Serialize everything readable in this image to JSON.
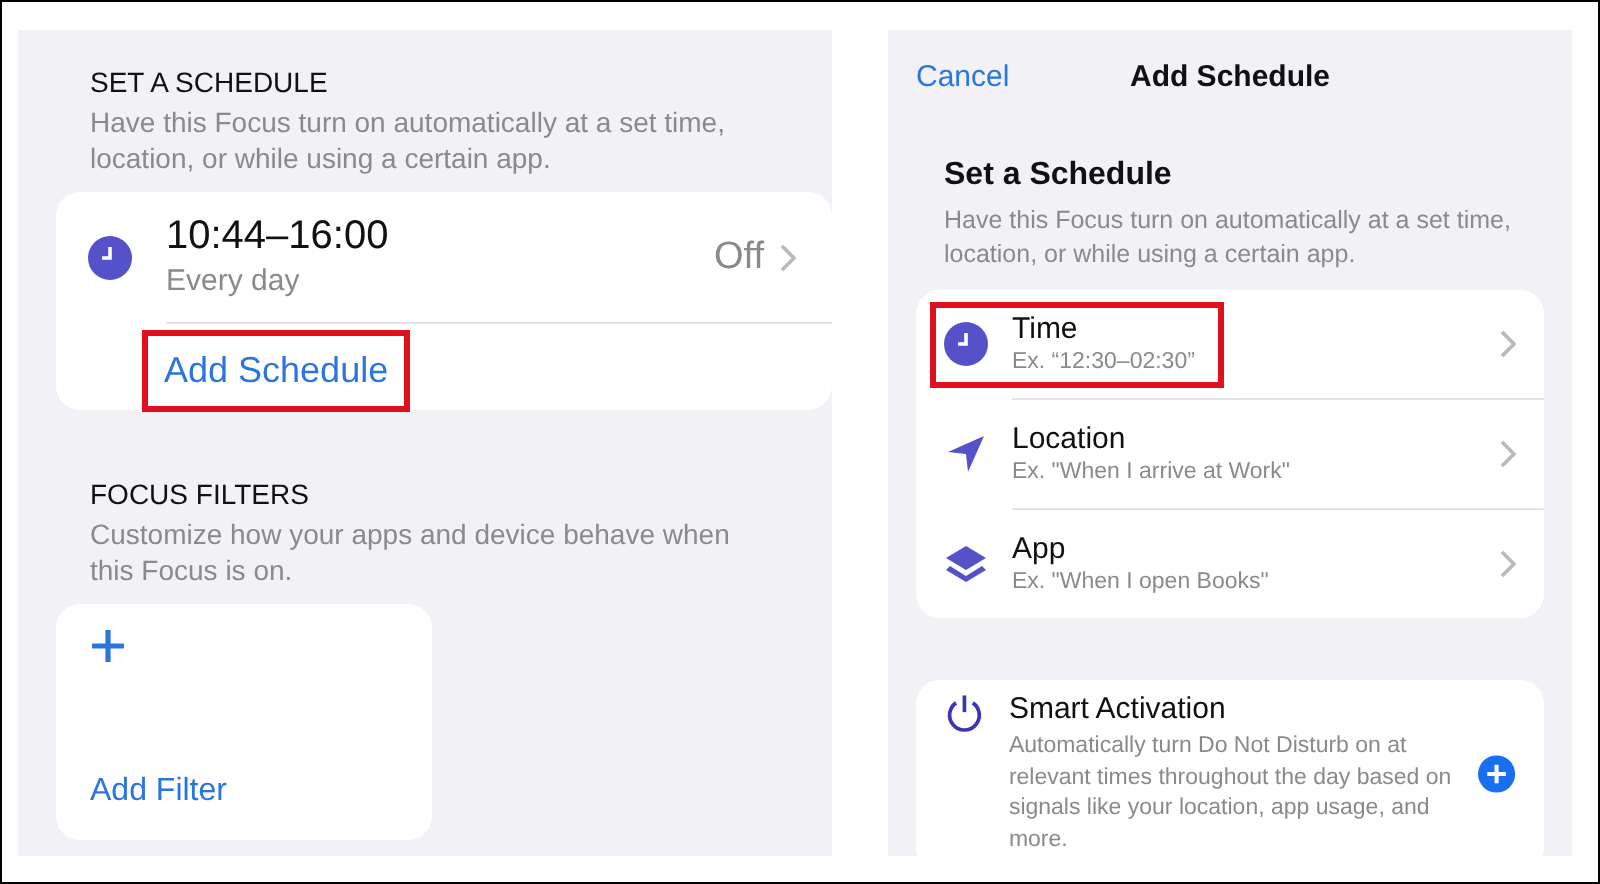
{
  "left": {
    "schedule_section": {
      "heading": "SET A SCHEDULE",
      "description": "Have this Focus turn on automatically at a set time, location, or while using a certain app.",
      "schedules": [
        {
          "time": "10:44–16:00",
          "repeat": "Every day",
          "status": "Off"
        }
      ],
      "add_button": {
        "label": "Add Schedule",
        "highlighted": true
      }
    },
    "filters_section": {
      "heading": "FOCUS FILTERS",
      "description": "Customize how your apps and device behave when this Focus is on.",
      "add_filter": {
        "label": "Add Filter"
      }
    }
  },
  "right": {
    "nav": {
      "cancel": "Cancel",
      "title": "Add Schedule"
    },
    "heading": "Set a Schedule",
    "description": "Have this Focus turn on automatically at a set time, location, or while using a certain app.",
    "options": [
      {
        "kind": "time",
        "title": "Time",
        "example": "Ex. “12:30–02:30”",
        "highlighted": true
      },
      {
        "kind": "location",
        "title": "Location",
        "example": "Ex. \"When I arrive at Work\"",
        "highlighted": false
      },
      {
        "kind": "app",
        "title": "App",
        "example": "Ex. \"When I open Books\"",
        "highlighted": false
      }
    ],
    "smart_activation": {
      "title": "Smart Activation",
      "description": "Automatically turn Do Not Disturb on at relevant times throughout the day based on signals like your location, app usage, and more."
    }
  }
}
